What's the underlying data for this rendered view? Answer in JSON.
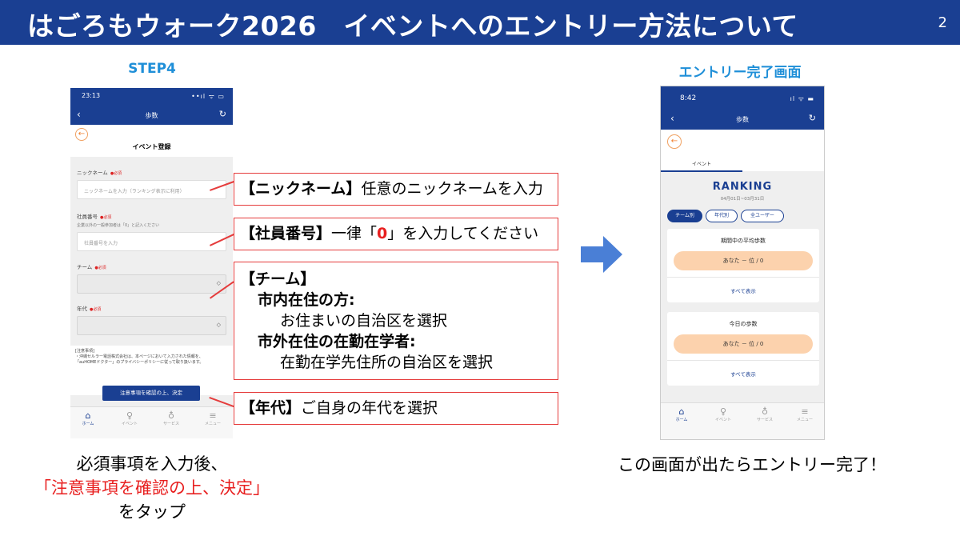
{
  "header": {
    "title": "はごろもウォーク2026　イベントへのエントリー方法について",
    "page_number": "2",
    "bar_color": "#1a3f92"
  },
  "left": {
    "step_label": "STEP4",
    "phone": {
      "time": "23:13",
      "signal": "••ıl ᯤ ▭",
      "back_icon": "‹",
      "nav_title": "歩数",
      "reload_icon": "↻",
      "form_title": "イベント登録",
      "nickname_label": "ニックネーム",
      "required_tag": "●必須",
      "nickname_placeholder": "ニックネームを入力（ランキング表示に利用）",
      "employee_label": "社員番号",
      "employee_hint": "企業以外の一般参加者は「0」と記入ください",
      "employee_placeholder": "社員番号を入力",
      "team_label": "チーム",
      "age_label": "年代",
      "notice_title": "[注意事項]",
      "notice_line1": "・沖縄セルラー電話株式会社は、本ページにおいて入力された情報を、",
      "notice_line2": "「auHOMEドクター」のプライバシーポリシーに従って取り扱います。",
      "submit_label": "注意事項を確認の上、決定",
      "tabs": [
        {
          "icon": "⌂",
          "label": "ホーム"
        },
        {
          "icon": "♀",
          "label": "イベント"
        },
        {
          "icon": "♁",
          "label": "サービス"
        },
        {
          "icon": "≡",
          "label": "メニュー"
        }
      ]
    },
    "caption_line1": "必須事項を入力後、",
    "caption_line2": "「注意事項を確認の上、決定」",
    "caption_line3": "をタップ"
  },
  "callouts": {
    "nickname_bold": "【ニックネーム】",
    "nickname_text": "任意のニックネームを入力",
    "employee_bold": "【社員番号】",
    "employee_text_pre": "一律「",
    "employee_zero": "0",
    "employee_text_post": "」を入力してください",
    "team_bold": "【チーム】",
    "team_city_head": "市内在住の方:",
    "team_city_body": "お住まいの自治区を選択",
    "team_out_head": "市外在住の在勤在学者:",
    "team_out_body": "在勤在学先住所の自治区を選択",
    "age_bold": "【年代】",
    "age_text": "ご自身の年代を選択",
    "border_color": "#e53c3c"
  },
  "right": {
    "label": "エントリー完了画面",
    "phone": {
      "time": "8:42",
      "signal": "ıl ᯤ ▬",
      "back_icon": "‹",
      "nav_title": "歩数",
      "reload_icon": "↻",
      "tab_label": "イベント",
      "ranking_title": "RANKING",
      "dates": "04月01日~03月31日",
      "chips": [
        "チーム別",
        "年代別",
        "全ユーザー"
      ],
      "card1_title": "期間中の平均歩数",
      "card1_value": "あなた － 位 / 0",
      "card1_all": "すべて表示",
      "card2_title": "今日の歩数",
      "card2_value": "あなた － 位 / 0",
      "card2_all": "すべて表示",
      "tabs": [
        {
          "icon": "⌂",
          "label": "ホーム"
        },
        {
          "icon": "♀",
          "label": "イベント"
        },
        {
          "icon": "♁",
          "label": "サービス"
        },
        {
          "icon": "≡",
          "label": "メニュー"
        }
      ]
    },
    "caption": "この画面が出たらエントリー完了！"
  },
  "arrow_color": "#4a7fd6"
}
